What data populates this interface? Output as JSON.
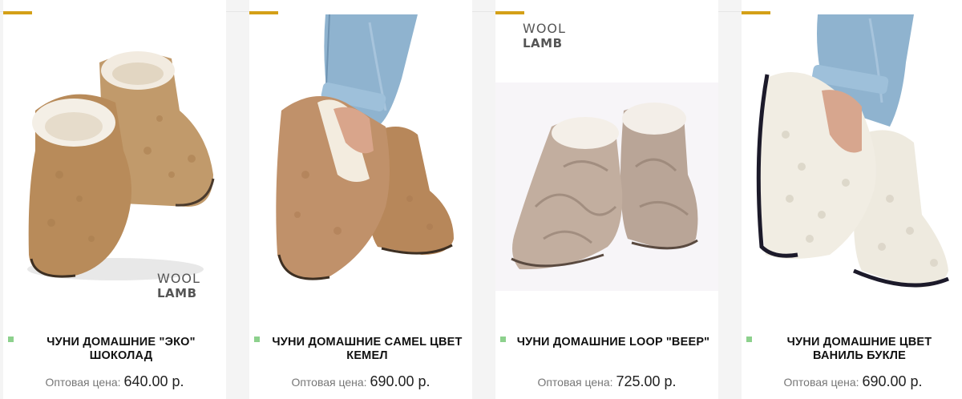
{
  "accent_color": "#d4a017",
  "badge_color": "#8dd18d",
  "products": [
    {
      "title": "ЧУНИ ДОМАШНИЕ \"ЭКО\" ШОКОЛАД",
      "price_label": "Оптовая цена:",
      "price_value": "640.00 р.",
      "brand_top": "WOOL",
      "brand_bottom": "LAMB",
      "image": "brown-sheepskin-booties"
    },
    {
      "title": "ЧУНИ ДОМАШНИЕ CAMEL ЦВЕТ КЕМЕЛ",
      "price_label": "Оптовая цена:",
      "price_value": "690.00 р.",
      "image": "camel-booties-on-foot"
    },
    {
      "title": "ЧУНИ ДОМАШНИЕ LOOP \"BEEP\"",
      "price_label": "Оптовая цена:",
      "price_value": "725.00 р.",
      "brand_top": "WOOL",
      "brand_bottom": "LAMB",
      "image": "beige-pattern-booties"
    },
    {
      "title": "ЧУНИ ДОМАШНИЕ ЦВЕТ ВАНИЛЬ БУКЛЕ",
      "price_label": "Оптовая цена:",
      "price_value": "690.00 р.",
      "image": "vanilla-boucle-booties-on-foot"
    }
  ]
}
